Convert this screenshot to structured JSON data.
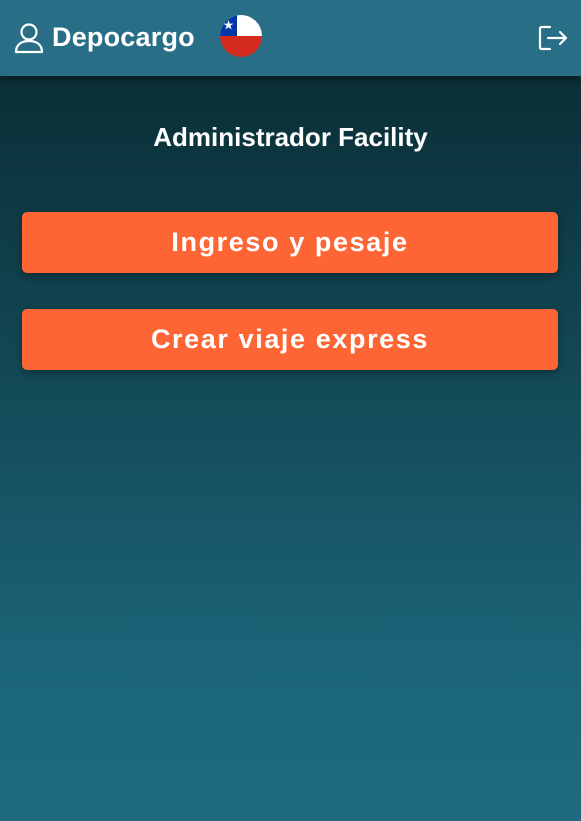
{
  "header": {
    "brand": "Depocargo",
    "user_icon": "user-icon",
    "flag_icon": "chile-flag-icon",
    "logout_icon": "logout-icon"
  },
  "main": {
    "title": "Administrador Facility",
    "buttons": [
      {
        "label": "Ingreso y pesaje"
      },
      {
        "label": "Crear viaje express"
      }
    ]
  },
  "colors": {
    "header_bg": "#276e86",
    "button_bg": "#fd6535",
    "bg_top": "#082830",
    "bg_bottom": "#1e6b80"
  }
}
